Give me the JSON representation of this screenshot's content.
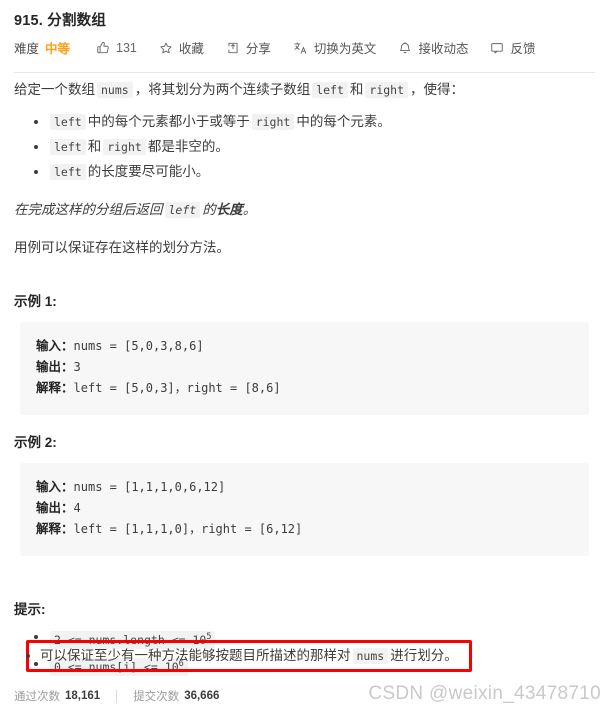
{
  "header": {
    "title": "915. 分割数组",
    "difficulty_label": "难度",
    "difficulty_value": "中等",
    "difficulty_color": "#ffa116",
    "actions": [
      {
        "icon": "thumbs-up-icon",
        "label": "131"
      },
      {
        "icon": "star-icon",
        "label": "收藏"
      },
      {
        "icon": "share-icon",
        "label": "分享"
      },
      {
        "icon": "translate-icon",
        "label": "切换为英文"
      },
      {
        "icon": "bell-icon",
        "label": "接收动态"
      },
      {
        "icon": "feedback-icon",
        "label": "反馈"
      }
    ]
  },
  "description": {
    "intro_part1": "给定一个数组",
    "intro_code1": "nums",
    "intro_part2": "，将其划分为两个连续子数组",
    "intro_code2": "left",
    "intro_part3": "和",
    "intro_code3": "right",
    "intro_part4": "，使得：",
    "bullets": [
      {
        "code1": "left",
        "text1": "中的每个元素都小于或等于",
        "code2": "right",
        "text2": "中的每个元素。"
      },
      {
        "code1": "left",
        "text1": "和",
        "code2": "right",
        "text2": "都是非空的。"
      },
      {
        "code1": "left",
        "text1": "的长度要尽可能小。",
        "code2": "",
        "text2": ""
      }
    ],
    "italic_part1": "在完成这样的分组后返回",
    "italic_code": "left",
    "italic_part2": "的",
    "italic_bold": "长度",
    "italic_part3": "。",
    "guarantee": "用例可以保证存在这样的划分方法。"
  },
  "examples": [
    {
      "heading": "示例 1:",
      "input_label": "输入：",
      "input_value": "nums = [5,0,3,8,6]",
      "output_label": "输出：",
      "output_value": "3",
      "explain_label": "解释：",
      "explain_value": "left = [5,0,3]，right = [8,6]"
    },
    {
      "heading": "示例 2:",
      "input_label": "输入：",
      "input_value": "nums = [1,1,1,0,6,12]",
      "output_label": "输出：",
      "output_value": "4",
      "explain_label": "解释：",
      "explain_value": "left = [1,1,1,0]，right = [6,12]"
    }
  ],
  "hints": {
    "heading": "提示:",
    "constraint1_base": "2 <= nums.length <= 10",
    "constraint1_exp": "5",
    "constraint2_base": "0 <= nums[i] <= 10",
    "constraint2_exp": "6",
    "highlighted_part1": "可以保证至少有一种方法能够按题目所描述的那样对",
    "highlighted_code": "nums",
    "highlighted_part2": "进行划分。",
    "highlight_color": "#f80000"
  },
  "footer": {
    "accepted_label": "通过次数",
    "accepted_value": "18,161",
    "submitted_label": "提交次数",
    "submitted_value": "36,666",
    "watermark": "CSDN @weixin_43478710"
  }
}
